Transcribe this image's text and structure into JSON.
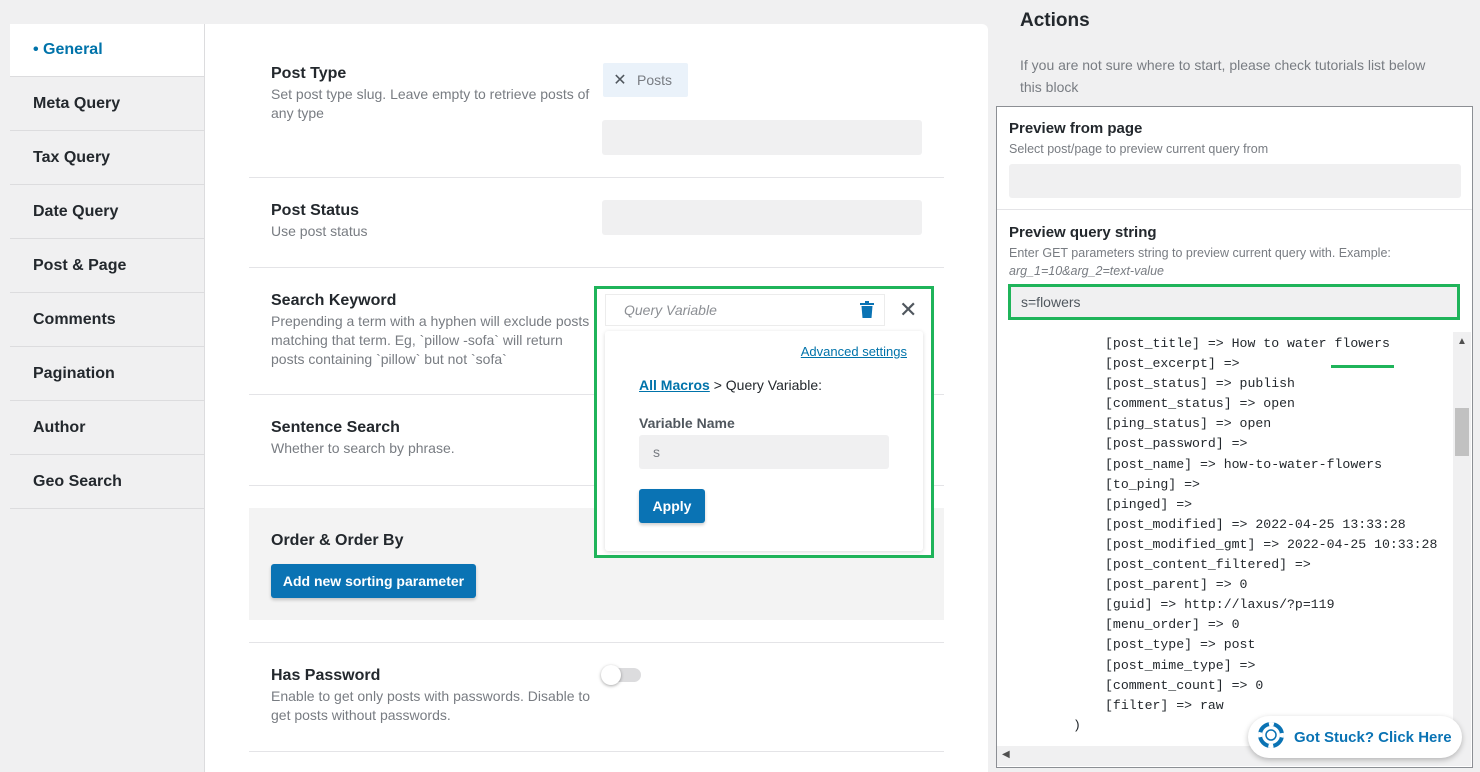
{
  "tabs": [
    {
      "label": "• General",
      "active": true
    },
    {
      "label": "Meta Query"
    },
    {
      "label": "Tax Query"
    },
    {
      "label": "Date Query"
    },
    {
      "label": "Post & Page"
    },
    {
      "label": "Comments"
    },
    {
      "label": "Pagination"
    },
    {
      "label": "Author"
    },
    {
      "label": "Geo Search"
    }
  ],
  "fields": {
    "post_type": {
      "label": "Post Type",
      "desc": "Set post type slug. Leave empty to retrieve posts of any type",
      "chip": "Posts"
    },
    "post_status": {
      "label": "Post Status",
      "desc": "Use post status"
    },
    "search_keyword": {
      "label": "Search Keyword",
      "desc": "Prepending a term with a hyphen will exclude posts matching that term. Eg, `pillow -sofa` will return posts containing `pillow` but not `sofa`"
    },
    "sentence_search": {
      "label": "Sentence Search",
      "desc": "Whether to search by phrase."
    },
    "order": {
      "label": "Order & Order By",
      "button": "Add new sorting parameter"
    },
    "has_password": {
      "label": "Has Password",
      "desc": "Enable to get only posts with passwords. Disable to get posts without passwords."
    }
  },
  "popup": {
    "header": "Query Variable",
    "advanced": "Advanced settings",
    "macros_link": "All Macros",
    "macros_rest": " > Query Variable:",
    "var_label": "Variable Name",
    "var_value": "s",
    "apply": "Apply"
  },
  "actions": {
    "title": "Actions",
    "desc": "If you are not sure where to start, please check tutorials list below this block",
    "preview_page_title": "Preview from page",
    "preview_page_desc": "Select post/page to preview current query from",
    "preview_qs_title": "Preview query string",
    "preview_qs_desc": "Enter GET parameters string to preview current query with. Example:",
    "preview_qs_example": "arg_1=10&arg_2=text-value",
    "query_string": "s=flowers"
  },
  "code_lines": [
    "[post_title] => How to water flowers",
    "[post_excerpt] =>",
    "[post_status] => publish",
    "[comment_status] => open",
    "[ping_status] => open",
    "[post_password] =>",
    "[post_name] => how-to-water-flowers",
    "[to_ping] =>",
    "[pinged] =>",
    "[post_modified] => 2022-04-25 13:33:28",
    "[post_modified_gmt] => 2022-04-25 10:33:28",
    "[post_content_filtered] =>",
    "[post_parent] => 0",
    "[guid] => http://laxus/?p=119",
    "[menu_order] => 0",
    "[post_type] => post",
    "[post_mime_type] =>",
    "[comment_count] => 0",
    "[filter] => raw"
  ],
  "code_close": ")",
  "help": {
    "label": "Got Stuck? Click Here"
  },
  "colors": {
    "accent": "#0a73b4",
    "highlight": "#1fb45a"
  }
}
